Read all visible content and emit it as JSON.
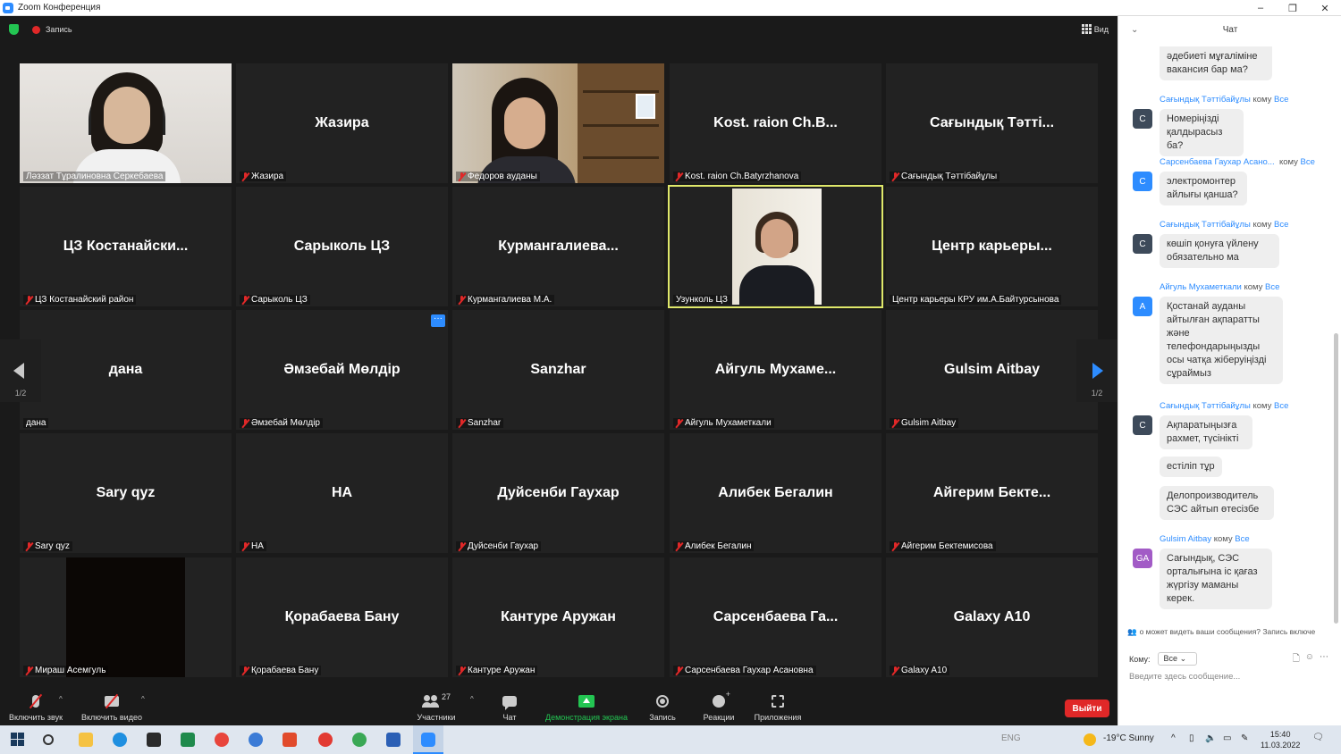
{
  "window": {
    "title": "Zoom Конференция",
    "min": "–",
    "max": "❐",
    "close": "✕"
  },
  "topbar": {
    "recording_label": "Запись",
    "view_label": "Вид"
  },
  "tiles": [
    {
      "label": "Ләззат Тұралиновна Серкебаева"
    },
    {
      "name": "Жазира",
      "label": "Жазира"
    },
    {
      "label": "Федоров ауданы"
    },
    {
      "name": "Kost. raion Ch.B...",
      "label": "Kost. raion Ch.Batyrzhanova"
    },
    {
      "name": "Сағындық Тәтті...",
      "label": "Сағындық Тәттібайұлы"
    },
    {
      "name": "ЦЗ Костанайски...",
      "label": "ЦЗ Костанайский район"
    },
    {
      "name": "Сарыколь ЦЗ",
      "label": "Сарыколь ЦЗ"
    },
    {
      "name": "Курмангалиева...",
      "label": "Курмангалиева М.А."
    },
    {
      "label": "Узунколь ЦЗ"
    },
    {
      "name": "Центр карьеры...",
      "label": "Центр карьеры КРУ им.А.Байтурсынова"
    },
    {
      "name": "дана",
      "label": "дана"
    },
    {
      "name": "Әмзебай Мөлдір",
      "label": "Әмзебай Мөлдір"
    },
    {
      "name": "Sanzhar",
      "label": "Sanzhar"
    },
    {
      "name": "Айгуль Мухаме...",
      "label": "Айгуль Мухаметкали"
    },
    {
      "name": "Gulsim Aitbay",
      "label": "Gulsim Aitbay"
    },
    {
      "name": "Sary qyz",
      "label": "Sary qyz"
    },
    {
      "name": "НА",
      "label": "НА"
    },
    {
      "name": "Дуйсенби Гаухар",
      "label": "Дуйсенби Гаухар"
    },
    {
      "name": "Алибек Бегалин",
      "label": "Алибек Бегалин"
    },
    {
      "name": "Айгерим Бекте...",
      "label": "Айгерим Бектемисова"
    },
    {
      "label": "Мираш Асемгуль"
    },
    {
      "name": "Қорабаева Бану",
      "label": "Қорабаева Бану"
    },
    {
      "name": "Кантуре Аружан",
      "label": "Кантуре Аружан"
    },
    {
      "name": "Сарсенбаева Га...",
      "label": "Сарсенбаева Гаухар Асановна"
    },
    {
      "name": "Galaxy A10",
      "label": "Galaxy A10"
    }
  ],
  "pager": {
    "prev": "1/2",
    "next": "1/2",
    "more": "···"
  },
  "toolbar": {
    "audio": "Включить звук",
    "video": "Включить видео",
    "participants": "Участники",
    "participants_count": "27",
    "chat": "Чат",
    "share": "Демонстрация экрана",
    "record": "Запись",
    "reactions": "Реакции",
    "apps": "Приложения",
    "leave": "Выйти",
    "caret": "^"
  },
  "chat": {
    "title": "Чат",
    "collapse": "⌄",
    "to_word": "кому",
    "everyone": "Все",
    "messages": [
      {
        "text": "әдебиеті мұғаліміне вакансия бар ма?"
      },
      {
        "sender": "Сағындық Тәттібайұлы",
        "avatar": "С",
        "text": "Номеріңізді қалдырасыз ба?"
      },
      {
        "sender": "Сарсенбаева Гаухар Асано...",
        "avatar": "С",
        "text": "электромонтер айлығы қанша?"
      },
      {
        "sender": "Сағындық Тәттібайұлы",
        "avatar": "С",
        "text": "көшіп қонуға үйлену обязательно ма"
      },
      {
        "sender": "Айгуль Мухаметкали",
        "avatar": "А",
        "text": "Қостанай ауданы айтылған ақпаратты және телефондарыңызды осы чатқа жіберуіңізді сұраймыз"
      },
      {
        "sender": "Сағындық Тәттібайұлы",
        "avatar": "С",
        "text": "Ақпаратыңызға рахмет, түсінікті"
      },
      {
        "text": "естіліп тұр"
      },
      {
        "text": "Делопроизводитель СЭС айтып өтесізбе"
      },
      {
        "sender": "Gulsim Aitbay",
        "avatar": "GA",
        "text": "Сағындық, СЭС орталығына іс қағаз жүргізу маманы керек."
      }
    ],
    "privacy_note": "о может видеть ваши сообщения? Запись включе",
    "to_label": "Кому:",
    "to_value": "Все",
    "input_placeholder": "Введите здесь сообщение..."
  },
  "colors": {
    "accent": "#2d8cff",
    "leave": "#e02828",
    "active_speaker": "#dfe86a",
    "share_green": "#23c552"
  },
  "taskbar": {
    "weather": "-19°C  Sunny",
    "time": "15:40",
    "date": "11.03.2022",
    "lang": "ENG"
  }
}
